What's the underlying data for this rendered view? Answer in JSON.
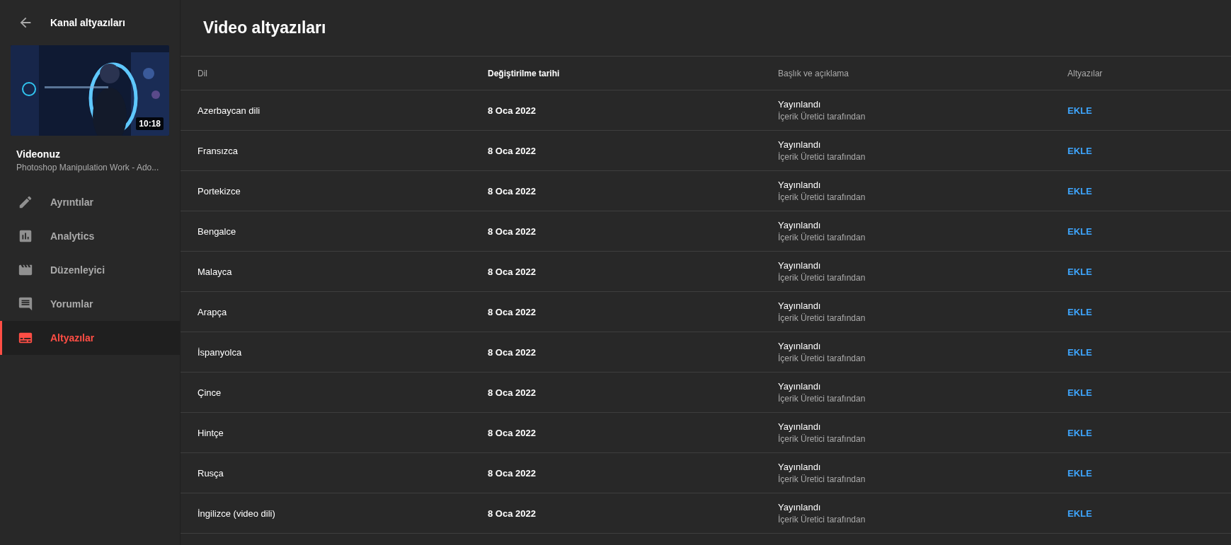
{
  "sidebar": {
    "title": "Kanal altyazıları",
    "video": {
      "duration": "10:18",
      "label": "Videonuz",
      "title": "Photoshop Manipulation Work - Ado..."
    },
    "items": [
      {
        "label": "Ayrıntılar",
        "selected": false
      },
      {
        "label": "Analytics",
        "selected": false
      },
      {
        "label": "Düzenleyici",
        "selected": false
      },
      {
        "label": "Yorumlar",
        "selected": false
      },
      {
        "label": "Altyazılar",
        "selected": true
      }
    ]
  },
  "page_title": "Video altyazıları",
  "table": {
    "columns": [
      {
        "label": "Dil",
        "sorted": false
      },
      {
        "label": "Değiştirilme tarihi",
        "sorted": true
      },
      {
        "label": "Başlık ve açıklama",
        "sorted": false
      },
      {
        "label": "Altyazılar",
        "sorted": false
      }
    ],
    "rows": [
      {
        "language": "Azerbaycan dili",
        "date": "8 Oca 2022",
        "status": "Yayınlandı",
        "by": "İçerik Üretici tarafından",
        "action": "EKLE"
      },
      {
        "language": "Fransızca",
        "date": "8 Oca 2022",
        "status": "Yayınlandı",
        "by": "İçerik Üretici tarafından",
        "action": "EKLE"
      },
      {
        "language": "Portekizce",
        "date": "8 Oca 2022",
        "status": "Yayınlandı",
        "by": "İçerik Üretici tarafından",
        "action": "EKLE"
      },
      {
        "language": "Bengalce",
        "date": "8 Oca 2022",
        "status": "Yayınlandı",
        "by": "İçerik Üretici tarafından",
        "action": "EKLE"
      },
      {
        "language": "Malayca",
        "date": "8 Oca 2022",
        "status": "Yayınlandı",
        "by": "İçerik Üretici tarafından",
        "action": "EKLE"
      },
      {
        "language": "Arapça",
        "date": "8 Oca 2022",
        "status": "Yayınlandı",
        "by": "İçerik Üretici tarafından",
        "action": "EKLE"
      },
      {
        "language": "İspanyolca",
        "date": "8 Oca 2022",
        "status": "Yayınlandı",
        "by": "İçerik Üretici tarafından",
        "action": "EKLE"
      },
      {
        "language": "Çince",
        "date": "8 Oca 2022",
        "status": "Yayınlandı",
        "by": "İçerik Üretici tarafından",
        "action": "EKLE"
      },
      {
        "language": "Hintçe",
        "date": "8 Oca 2022",
        "status": "Yayınlandı",
        "by": "İçerik Üretici tarafından",
        "action": "EKLE"
      },
      {
        "language": "Rusça",
        "date": "8 Oca 2022",
        "status": "Yayınlandı",
        "by": "İçerik Üretici tarafından",
        "action": "EKLE"
      },
      {
        "language": "İngilizce (video dili)",
        "date": "8 Oca 2022",
        "status": "Yayınlandı",
        "by": "İçerik Üretici tarafından",
        "action": "EKLE"
      }
    ]
  }
}
